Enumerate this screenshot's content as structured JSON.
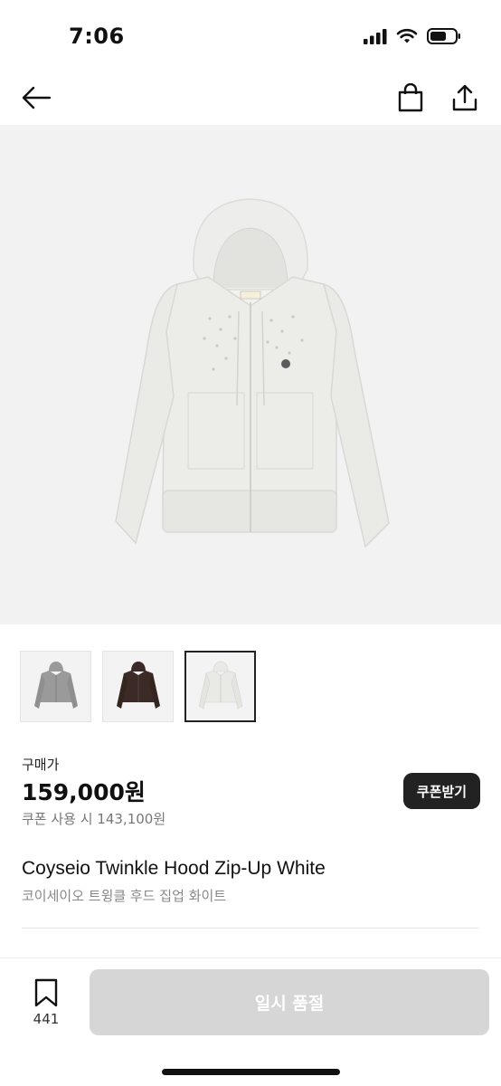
{
  "status_bar": {
    "time": "7:06",
    "icons": [
      "signal-icon",
      "wifi-icon",
      "battery-icon"
    ]
  },
  "nav": {
    "back_icon": "arrow-left-icon",
    "bag_icon": "shopping-bag-icon",
    "share_icon": "share-icon"
  },
  "gallery": {
    "thumbnails": [
      {
        "icon": "hoodie-gray-thumbnail",
        "color": "#9a9a9a",
        "selected": false
      },
      {
        "icon": "hoodie-brown-thumbnail",
        "color": "#3b2a25",
        "selected": false
      },
      {
        "icon": "hoodie-white-thumbnail",
        "color": "#e9e9e6",
        "selected": true
      }
    ]
  },
  "pricing": {
    "label": "구매가",
    "price": "159,000원",
    "coupon_price": "쿠폰 사용 시 143,100원",
    "coupon_button": "쿠폰받기"
  },
  "product": {
    "name": "Coyseio Twinkle Hood Zip-Up White",
    "name_ko": "코이세이오 트윙클 후드 집업 화이트"
  },
  "bottom_bar": {
    "wish_icon": "bookmark-icon",
    "wish_count": "441",
    "sold_out_label": "일시 품절"
  },
  "colors": {
    "accent_dark": "#222222",
    "disabled_button": "#d6d6d6",
    "hero_background": "#f2f2f2"
  }
}
